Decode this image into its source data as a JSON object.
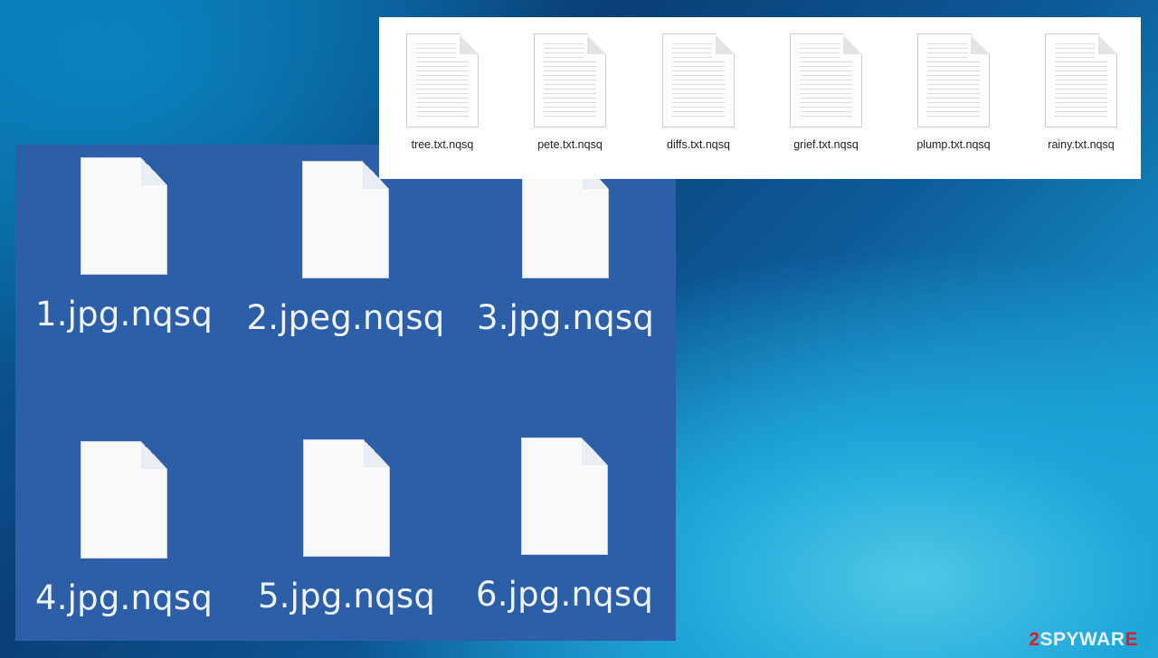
{
  "large_panel": {
    "files": [
      {
        "name": "1.jpg.nqsq"
      },
      {
        "name": "2.jpeg.nqsq"
      },
      {
        "name": "3.jpg.nqsq"
      },
      {
        "name": "4.jpg.nqsq"
      },
      {
        "name": "5.jpg.nqsq"
      },
      {
        "name": "6.jpg.nqsq"
      }
    ]
  },
  "small_panel": {
    "files": [
      {
        "name": "tree.txt.nqsq"
      },
      {
        "name": "pete.txt.nqsq"
      },
      {
        "name": "diffs.txt.nqsq"
      },
      {
        "name": "grief.txt.nqsq"
      },
      {
        "name": "plump.txt.nqsq"
      },
      {
        "name": "rainy.txt.nqsq"
      }
    ]
  },
  "watermark": {
    "prefix": "2",
    "main": "SPYWAR",
    "suffix": "E"
  },
  "colors": {
    "panel_blue": "#2c5fa8",
    "watermark_accent": "#d82028"
  }
}
